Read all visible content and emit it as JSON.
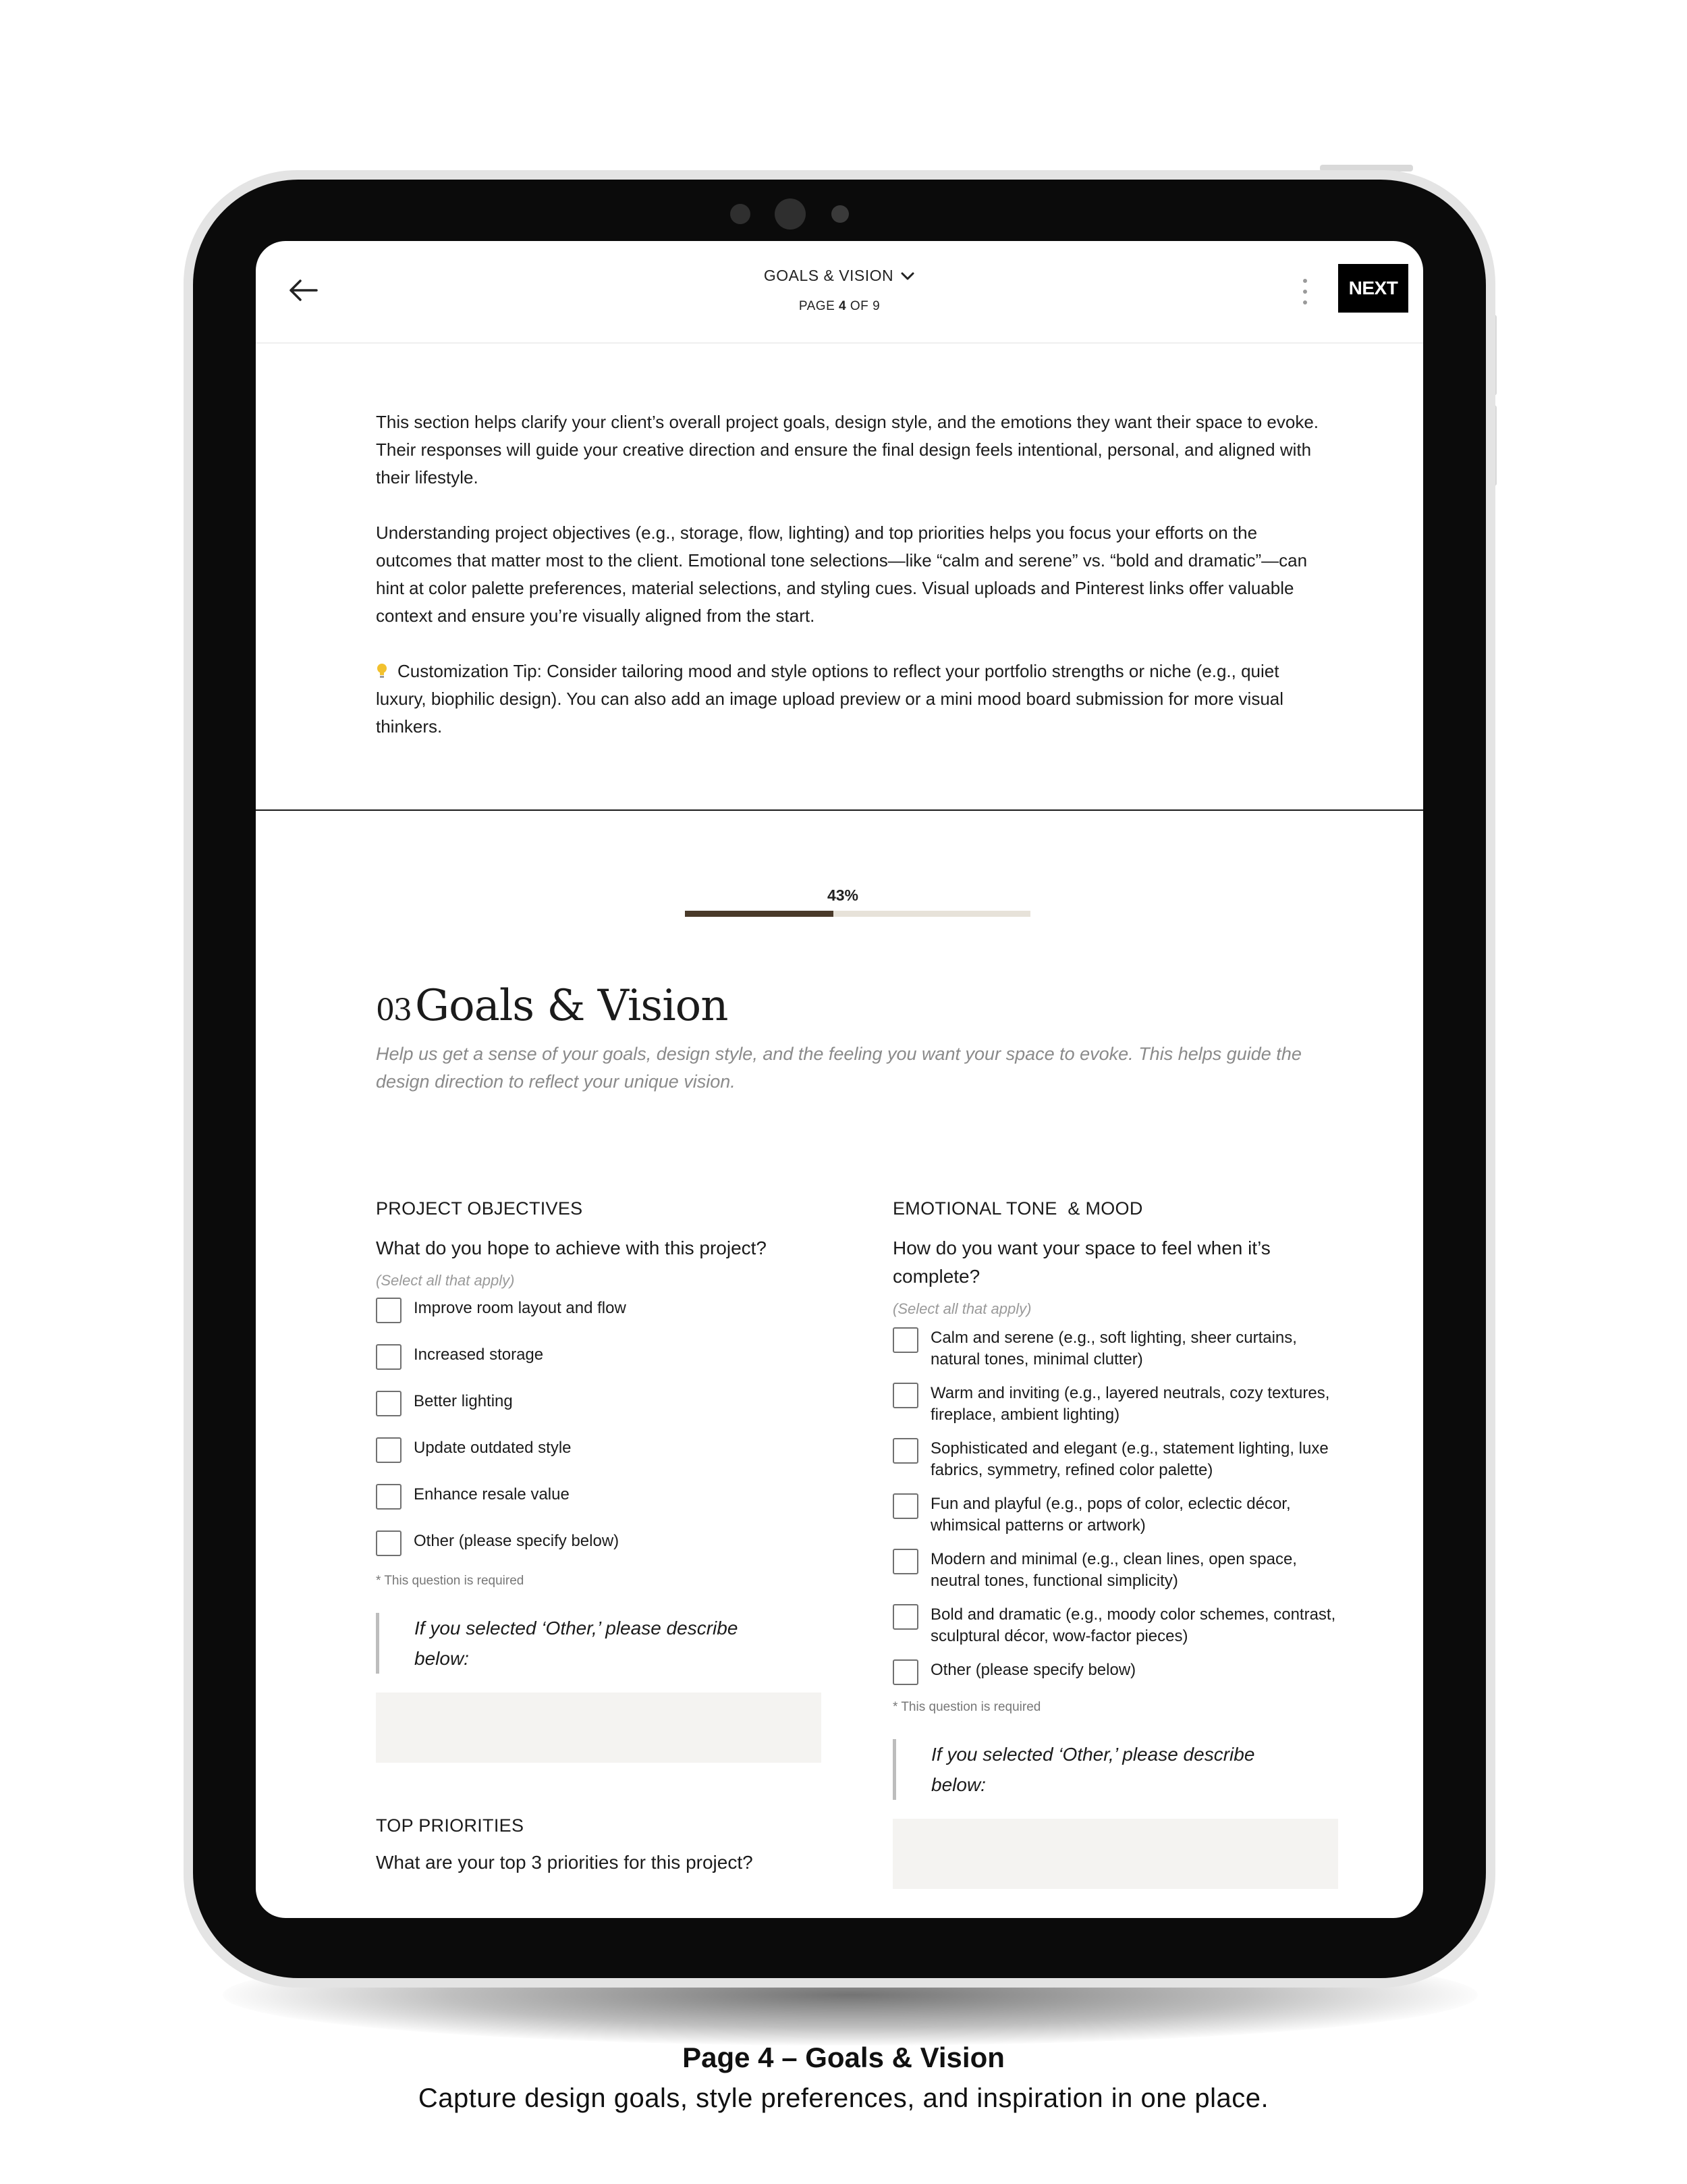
{
  "header": {
    "section_title": "GOALS & VISION",
    "page_prefix": "PAGE",
    "page_current": "4",
    "page_middle": "OF",
    "page_total": "9",
    "next_label": "NEXT"
  },
  "intro": {
    "paragraph_1": "This section helps clarify your client’s overall project goals, design style, and the emotions they want their space to evoke. Their responses will guide your creative direction and ensure the final design feels intentional, personal, and aligned with their lifestyle.",
    "paragraph_2": "Understanding project objectives (e.g., storage, flow, lighting) and top priorities helps you focus your efforts on the outcomes that matter most to the client. Emotional tone selections—like “calm and serene” vs. “bold and dramatic”—can hint at color palette preferences, material selections, and styling cues. Visual uploads and Pinterest links offer valuable context and ensure you’re visually aligned from the start.",
    "tip": "Customization Tip: Consider tailoring mood and style options to reflect your portfolio strengths or niche (e.g., quiet luxury, biophilic design). You can also add an image upload preview or a mini mood board submission for more visual thinkers."
  },
  "progress": {
    "label": "43%",
    "value": 0.43
  },
  "form": {
    "number": "03",
    "title": "Goals & Vision",
    "subtitle": "Help us get a sense of your goals, design style, and the feeling you want your space to evoke. This helps guide the design direction to reflect your unique vision."
  },
  "objectives": {
    "section": "PROJECT OBJECTIVES",
    "question": "What do you hope to achieve with this project?",
    "hint": "(Select all that apply)",
    "options": [
      "Improve room layout and flow",
      "Increased storage",
      "Better lighting",
      "Update outdated style",
      "Enhance resale value",
      "Other (please specify below)"
    ],
    "required": "* This question is required",
    "other_prompt": "If you selected ‘Other,’ please describe below:"
  },
  "emotional": {
    "section": "EMOTIONAL TONE  & MOOD",
    "question": "How do you want your space to feel when it’s complete?",
    "hint": "(Select all that apply)",
    "options": [
      "Calm and serene (e.g., soft lighting, sheer curtains, natural tones, minimal clutter)",
      "Warm and inviting (e.g., layered neutrals, cozy textures, fireplace, ambient lighting)",
      "Sophisticated and elegant (e.g., statement lighting, luxe fabrics, symmetry, refined color palette)",
      "Fun and playful (e.g., pops of color, eclectic décor, whimsical patterns or artwork)",
      "Modern and minimal (e.g., clean lines, open space, neutral tones, functional simplicity)",
      "Bold and dramatic (e.g., moody color schemes, contrast, sculptural décor, wow-factor pieces)",
      "Other (please specify below)"
    ],
    "required": "* This question is required",
    "other_prompt": "If you selected ‘Other,’ please describe below:"
  },
  "priorities": {
    "section": "TOP PRIORITIES",
    "question": "What are your top 3 priorities for this project?"
  },
  "caption": {
    "title": "Page 4 – Goals & Vision",
    "subtitle": "Capture design goals, style preferences, and inspiration in one place."
  },
  "colors": {
    "progress_fill": "#4a3a2a",
    "progress_track": "#e7e2d9",
    "next_button": "#000000",
    "input_background": "#f4f3f1"
  }
}
